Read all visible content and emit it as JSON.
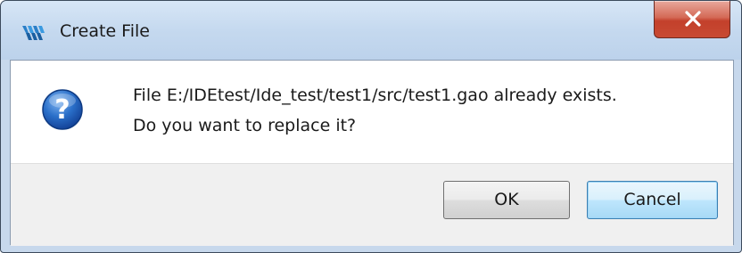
{
  "window": {
    "title": "Create File",
    "app_icon": "gowin-logo-icon",
    "close_icon": "close-x-icon"
  },
  "dialog": {
    "icon": "question-icon",
    "message_line1": "File E:/IDEtest/Ide_test/test1/src/test1.gao already exists.",
    "message_line2": "Do you want to replace it?"
  },
  "buttons": {
    "ok_label": "OK",
    "cancel_label": "Cancel"
  },
  "colors": {
    "titlebar": "#c5d9ef",
    "close_button": "#c84a33",
    "question_icon": "#1f5fb5",
    "focused_button_border": "#3c7fb1"
  }
}
